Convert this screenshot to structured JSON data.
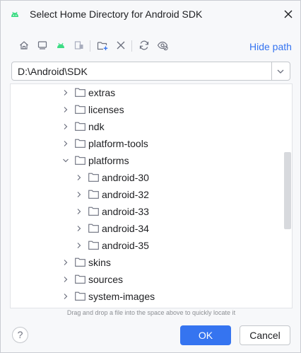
{
  "dialog": {
    "title": "Select Home Directory for Android SDK",
    "logo_icon": "android-studio-logo",
    "close_icon": "close-icon"
  },
  "toolbar": {
    "icons": [
      "home-icon",
      "desktop-icon",
      "android-icon",
      "project-icon",
      "new-folder-icon",
      "delete-icon",
      "refresh-icon",
      "show-hidden-icon"
    ],
    "hide_path_label": "Hide path"
  },
  "path": {
    "value": "D:\\Android\\SDK"
  },
  "tree": {
    "items": [
      {
        "label": "extras",
        "level": 1,
        "expanded": false
      },
      {
        "label": "licenses",
        "level": 1,
        "expanded": false
      },
      {
        "label": "ndk",
        "level": 1,
        "expanded": false
      },
      {
        "label": "platform-tools",
        "level": 1,
        "expanded": false
      },
      {
        "label": "platforms",
        "level": 1,
        "expanded": true
      },
      {
        "label": "android-30",
        "level": 2,
        "expanded": false
      },
      {
        "label": "android-32",
        "level": 2,
        "expanded": false
      },
      {
        "label": "android-33",
        "level": 2,
        "expanded": false
      },
      {
        "label": "android-34",
        "level": 2,
        "expanded": false
      },
      {
        "label": "android-35",
        "level": 2,
        "expanded": false
      },
      {
        "label": "skins",
        "level": 1,
        "expanded": false
      },
      {
        "label": "sources",
        "level": 1,
        "expanded": false
      },
      {
        "label": "system-images",
        "level": 1,
        "expanded": false
      }
    ]
  },
  "hint": "Drag and drop a file into the space above to quickly locate it",
  "buttons": {
    "help_label": "?",
    "ok_label": "OK",
    "cancel_label": "Cancel"
  },
  "colors": {
    "accent": "#3574f0",
    "android_green": "#3ddc84",
    "icon_gray": "#6c707e"
  }
}
